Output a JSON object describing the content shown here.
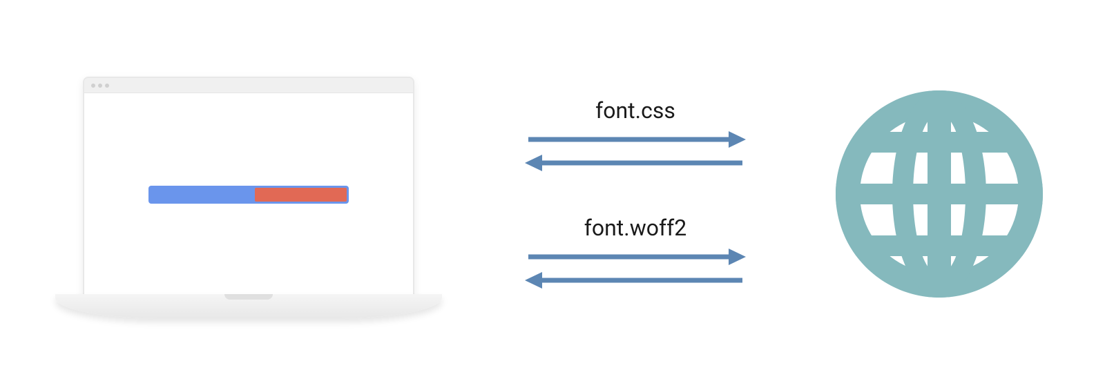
{
  "arrows": {
    "first_label": "font.css",
    "second_label": "font.woff2"
  },
  "colors": {
    "arrow": "#5c86b3",
    "globe": "#85b9bd",
    "progress_bg": "#6a95ec",
    "progress_fill": "#e16955"
  },
  "diagram": {
    "description": "Laptop requesting font resources from web server",
    "left_element": "laptop-browser",
    "right_element": "globe-server"
  }
}
